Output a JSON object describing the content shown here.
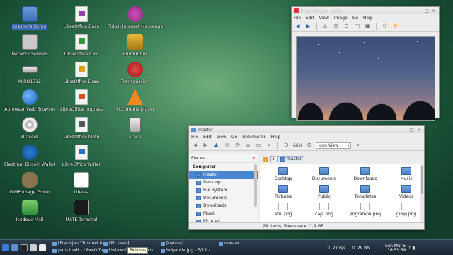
{
  "desktop": {
    "col1": [
      {
        "label": "master's Home",
        "icon": "home-folder-icon",
        "selected": true
      },
      {
        "label": "Network Servers",
        "icon": "network-icon"
      },
      {
        "label": "MJRO1712",
        "icon": "drive-icon"
      },
      {
        "label": "Abrowser Web Browser",
        "icon": "browser-icon"
      },
      {
        "label": "Brasero",
        "icon": "disc-burner-icon"
      },
      {
        "label": "Electrum Bitcoin Wallet",
        "icon": "bitcoin-wallet-icon"
      },
      {
        "label": "GIMP Image Editor",
        "icon": "gimp-icon"
      },
      {
        "label": "Icedove Mail",
        "icon": "mail-icon"
      }
    ],
    "col2": [
      {
        "label": "LibreOffice Base",
        "icon": "libreoffice-base-icon",
        "color": "#8e44ad"
      },
      {
        "label": "LibreOffice Calc",
        "icon": "libreoffice-calc-icon",
        "color": "#2e9b3a"
      },
      {
        "label": "LibreOffice Draw",
        "icon": "libreoffice-draw-icon",
        "color": "#d8a31b"
      },
      {
        "label": "LibreOffice Impress",
        "icon": "libreoffice-impress-icon",
        "color": "#d35420"
      },
      {
        "label": "LibreOffice Math",
        "icon": "libreoffice-math-icon",
        "color": "#555555"
      },
      {
        "label": "LibreOffice Writer",
        "icon": "libreoffice-writer-icon",
        "color": "#2a6fc4"
      },
      {
        "label": "Liferea",
        "icon": "rss-reader-icon"
      },
      {
        "label": "MATE Terminal",
        "icon": "terminal-icon"
      }
    ],
    "col3": [
      {
        "label": "Pidgin Internet Messenger",
        "icon": "pidgin-icon"
      },
      {
        "label": "Rhythmbox",
        "icon": "rhythmbox-icon"
      },
      {
        "label": "Transmission",
        "icon": "transmission-icon"
      },
      {
        "label": "VLC media player",
        "icon": "vlc-icon"
      },
      {
        "label": "Trash",
        "icon": "trash-icon"
      }
    ]
  },
  "image_viewer": {
    "title": "brigantia.jpg - 5/12",
    "menu": [
      "File",
      "Edit",
      "View",
      "Image",
      "Go",
      "Help"
    ]
  },
  "file_manager": {
    "title": "master",
    "menu": [
      "File",
      "Edit",
      "View",
      "Go",
      "Bookmarks",
      "Help"
    ],
    "zoom": "66%",
    "view_mode": "Icon View",
    "places_label": "Places",
    "sidebar_group": "Computer",
    "sidebar_items": [
      "master",
      "Desktop",
      "File System",
      "Documents",
      "Downloads",
      "Music",
      "Pictures"
    ],
    "breadcrumb": "master",
    "files": [
      "Desktop",
      "Documents",
      "Downloads",
      "Music",
      "Pictures",
      "Public",
      "Templates",
      "Videos",
      "atril.png",
      "caja.png",
      "engrampa.png",
      "gimp.png"
    ],
    "status": "29 items, Free space: 1,9 GB"
  },
  "taskbar": {
    "tasks": [
      {
        "label": "[Pratinjau \"Trisquel 8 ...",
        "col": 1
      },
      {
        "label": "[Pictures]",
        "col": 2
      },
      {
        "label": "part-1.odt - LibreOffic...",
        "col": 1
      },
      {
        "label": "[*viewnior.png - Pictures ...]",
        "col": 2
      },
      {
        "label": "[nature]",
        "col": 3
      },
      {
        "label": "brigantia.jpg - 5/12 - 1...",
        "col": 3
      },
      {
        "label": "master",
        "col": 4
      }
    ],
    "tooltip": "Pictures",
    "net_down": "27 B/s",
    "net_up": "29 B/s",
    "clock_date": "Sen Mar 5",
    "clock_time": "16:55:39"
  }
}
